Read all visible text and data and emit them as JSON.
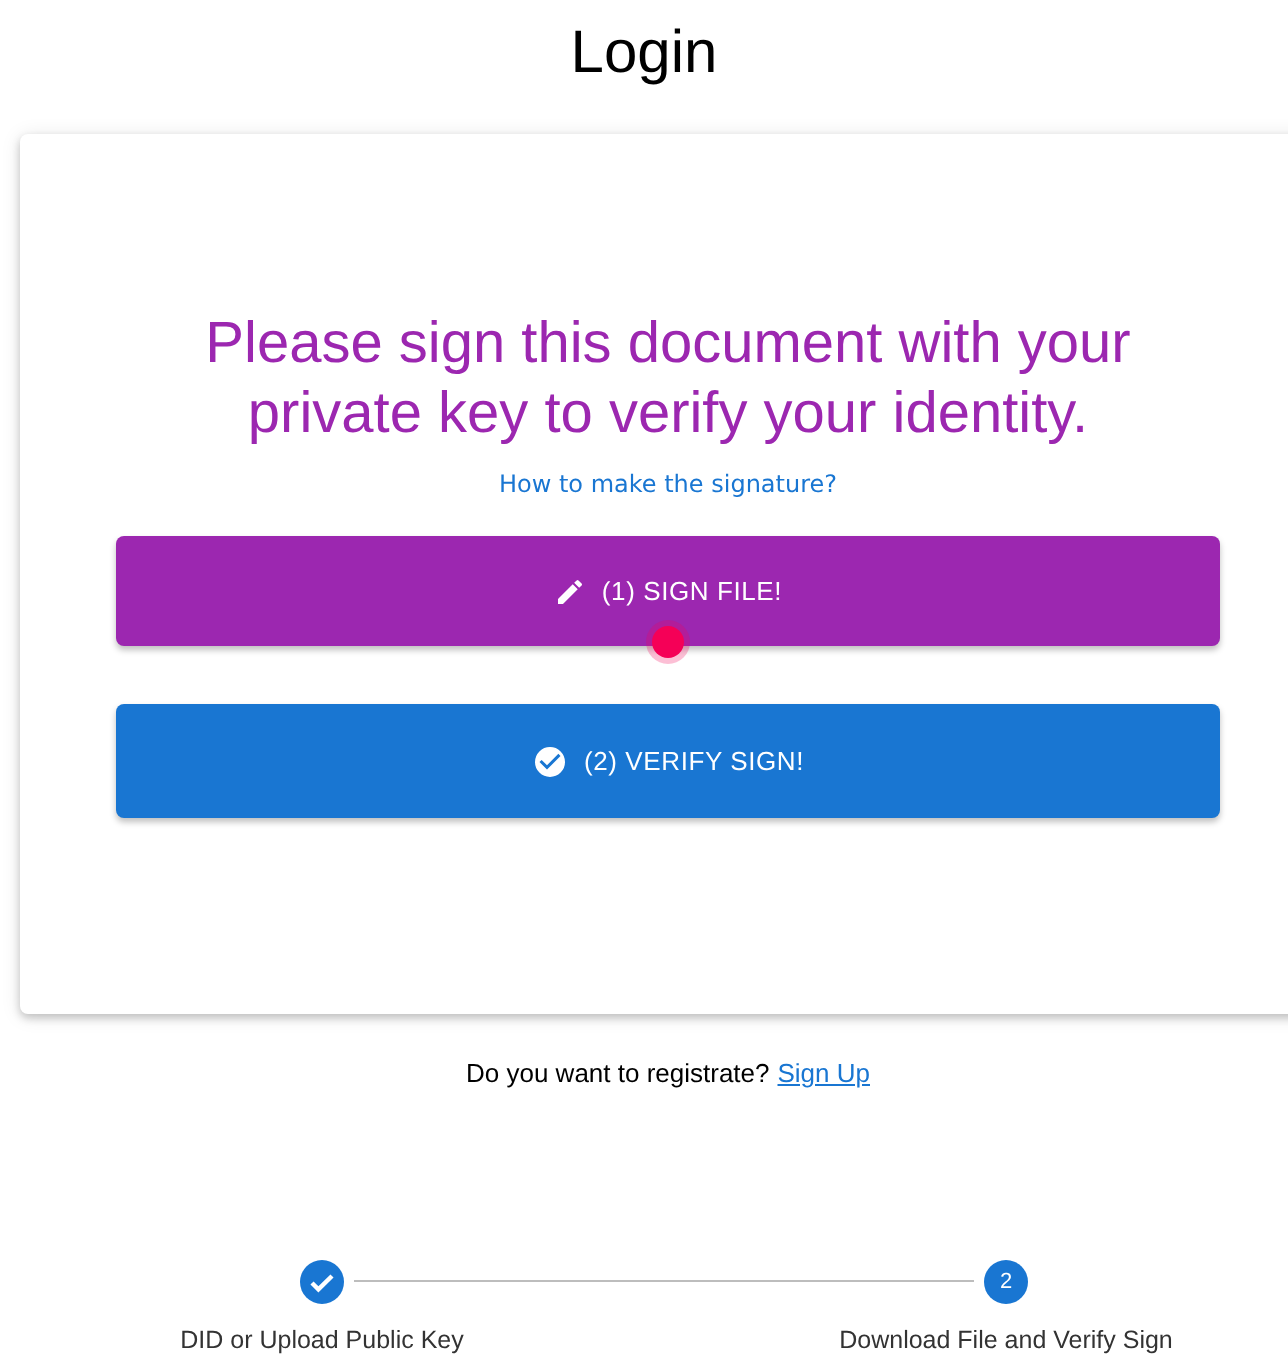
{
  "page_title": "Login",
  "card": {
    "heading": "Please sign this document with your private key to verify your identity.",
    "help_link": "How to make the signature?",
    "buttons": [
      {
        "kind": "sign",
        "label": "(1) SIGN FILE!"
      },
      {
        "kind": "verify",
        "label": "(2) VERIFY SIGN!"
      }
    ]
  },
  "register": {
    "prompt": "Do you want to registrate?",
    "link": "Sign Up"
  },
  "steps": [
    {
      "completed": true,
      "label": "DID or Upload Public Key"
    },
    {
      "completed": false,
      "number": "2",
      "label": "Download File and Verify Sign"
    }
  ]
}
